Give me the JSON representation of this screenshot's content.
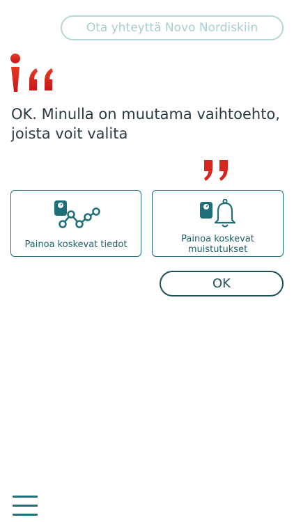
{
  "contact_button": "Ota yhteyttä Novo Nordiskiin",
  "message": "OK. Minulla on muutama vaihtoehto, joista voit valita",
  "options": [
    {
      "label": "Painoa koskevat tiedot",
      "icon": "scale-chart-icon"
    },
    {
      "label": "Painoa koskevat muistutukset",
      "icon": "scale-bell-icon"
    }
  ],
  "ok_button": "OK",
  "menu_icon": "hamburger-menu-icon",
  "colors": {
    "accent": "#1f6f7a",
    "quote_red": "#d7261e",
    "text": "#2c3a40"
  }
}
